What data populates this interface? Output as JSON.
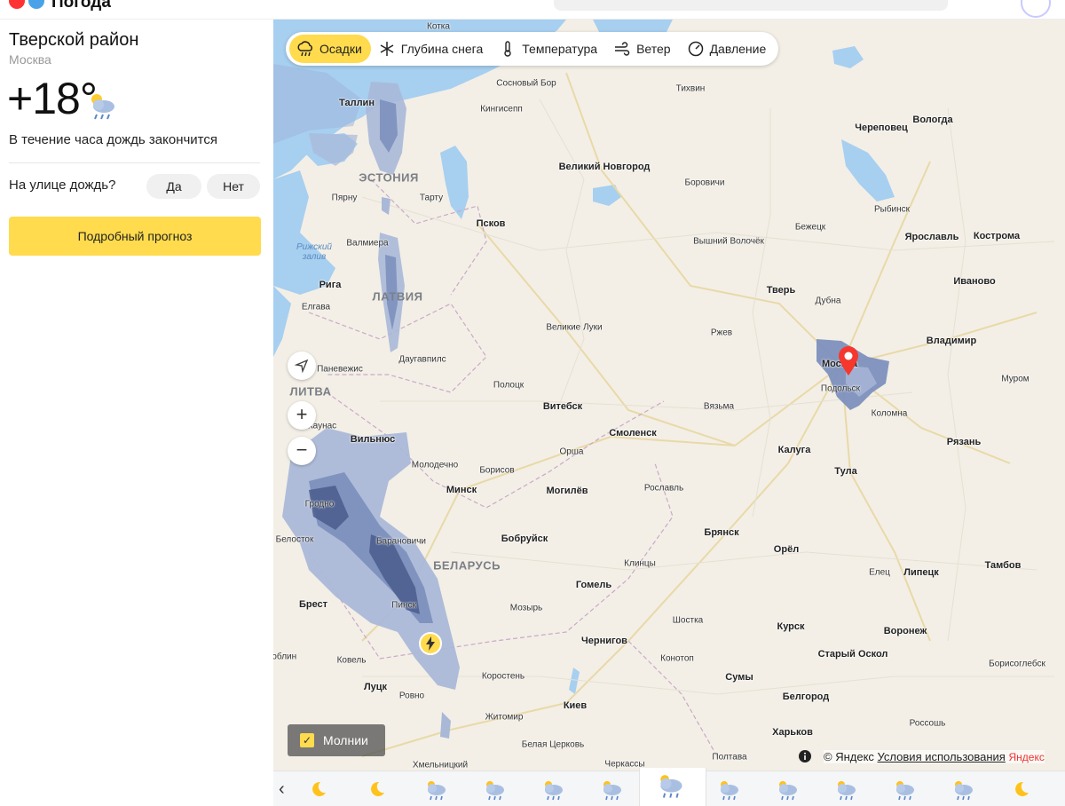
{
  "header": {
    "brand": "Погода"
  },
  "location": {
    "title": "Тверской район",
    "subtitle": "Москва"
  },
  "weather": {
    "temperature": "+18°",
    "icon": "cloud-rain-sun-icon",
    "note": "В течение часа дождь закончится"
  },
  "feedback": {
    "question": "На улице дождь?",
    "yes": "Да",
    "no": "Нет"
  },
  "forecast_button": "Подробный прогноз",
  "map_layers": [
    {
      "label": "Осадки",
      "icon": "rain-cloud-icon",
      "active": true
    },
    {
      "label": "Глубина снега",
      "icon": "snowflake-icon",
      "active": false
    },
    {
      "label": "Температура",
      "icon": "thermometer-icon",
      "active": false
    },
    {
      "label": "Ветер",
      "icon": "wind-icon",
      "active": false
    },
    {
      "label": "Давление",
      "icon": "gauge-icon",
      "active": false
    }
  ],
  "map_controls": {
    "locate": "navigation-arrow-icon",
    "zoom_in": "+",
    "zoom_out": "−"
  },
  "lightning_toggle": {
    "label": "Молнии",
    "checked": true
  },
  "copyright": {
    "text": "© Яндекс",
    "terms": "Условия использования",
    "brand": "Яндекс"
  },
  "countries": [
    "ЭСТОНИЯ",
    "ЛАТВИЯ",
    "ЛИТВА",
    "БЕЛАРУСЬ"
  ],
  "water_labels": [
    "Рижский залив"
  ],
  "cities": [
    "Котка",
    "Сосновый Бор",
    "Таллин",
    "Кингисепп",
    "Тихвин",
    "Вологда",
    "Череповец",
    "Великий Новгород",
    "Боровичи",
    "Тарту",
    "Пярну",
    "Псков",
    "Бежецк",
    "Рыбинск",
    "Вышний Волочёк",
    "Ярославль",
    "Кострома",
    "Валмиера",
    "Рига",
    "Елгава",
    "Тверь",
    "Дубна",
    "Иваново",
    "Великие Луки",
    "Ржев",
    "Владимир",
    "Панев­ежис",
    "Даугавпилс",
    "Москва",
    "Подольск",
    "Полоцк",
    "Витебск",
    "Вязьма",
    "Муром",
    "Коломна",
    "Каунас",
    "Вильнюс",
    "Смоленск",
    "Калуга",
    "Рязань",
    "Молодечно",
    "Борисов",
    "Орша",
    "Тула",
    "Гродно",
    "Минск",
    "Могилёв",
    "Рославль",
    "Белосток",
    "Барановичи",
    "Бобруйск",
    "Брянск",
    "Орёл",
    "Тамбов",
    "Клинцы",
    "Гомель",
    "Елец",
    "Липецк",
    "Брест",
    "Пинск",
    "Мозырь",
    "Шостка",
    "Курск",
    "Воронеж",
    "Чернигов",
    "Ковель",
    "Конотоп",
    "Старый Оскол",
    "Борисоглебск",
    "Луцк",
    "Коростень",
    "Сумы",
    "Белгород",
    "Ровно",
    "Киев",
    "Житомир",
    "Харьков",
    "Россошь",
    "Белая Церковь",
    "Полтава",
    "Хмельницкий",
    "Черкассы",
    "Люблин"
  ],
  "timeline": {
    "prev": "‹",
    "slots": [
      "moon",
      "moon",
      "rain-cloud",
      "rain-cloud",
      "rain-cloud",
      "rain-cloud",
      "rain-cloud-active",
      "rain-cloud",
      "rain-cloud",
      "rain-cloud",
      "rain-cloud",
      "rain-cloud",
      "moon"
    ]
  },
  "colors": {
    "accent": "#ffdb4d",
    "rain_light": "#aab8d8",
    "rain_mid": "#7d90bd",
    "rain_dark": "#4d5f8f",
    "water": "#a7cff0",
    "land": "#f3efe6",
    "pin": "#f5372e"
  }
}
